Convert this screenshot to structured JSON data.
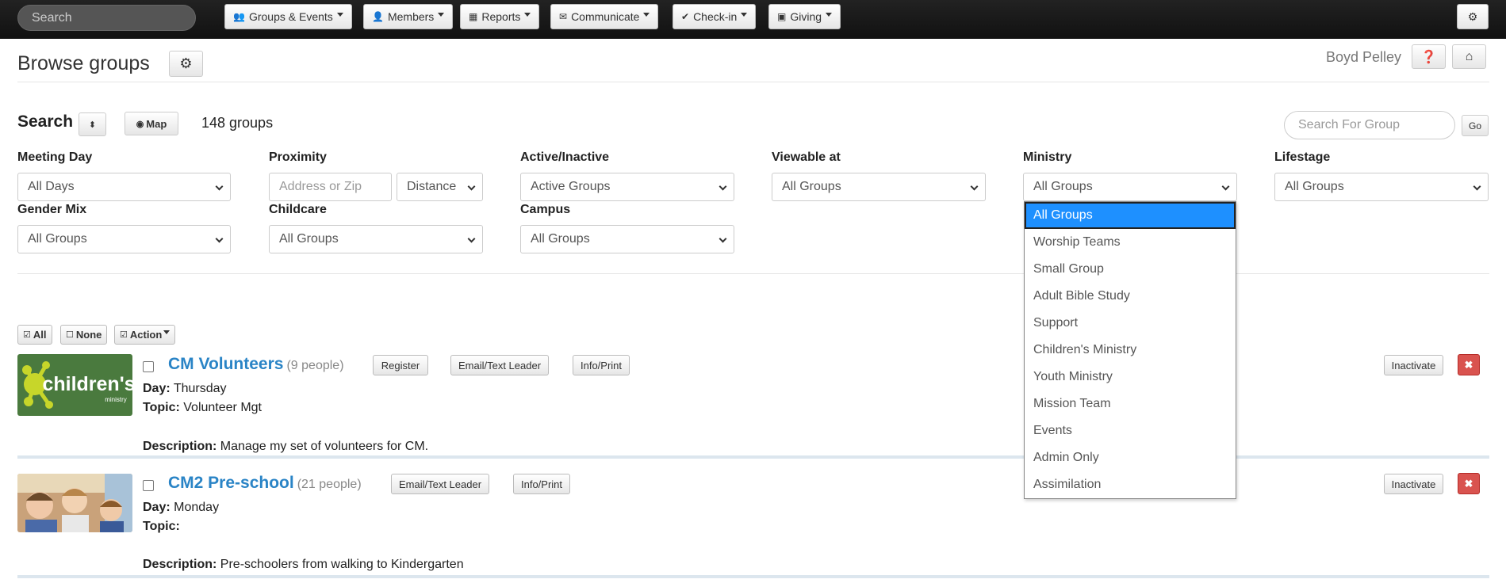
{
  "topnav": {
    "search_placeholder": "Search",
    "menus": [
      {
        "label": "Groups & Events",
        "icon": "users-icon"
      },
      {
        "label": "Members",
        "icon": "user-icon"
      },
      {
        "label": "Reports",
        "icon": "table-icon"
      },
      {
        "label": "Communicate",
        "icon": "envelope-icon"
      },
      {
        "label": "Check-in",
        "icon": "check-icon"
      },
      {
        "label": "Giving",
        "icon": "money-icon"
      }
    ]
  },
  "header": {
    "title": "Browse groups",
    "user_name": "Boyd Pelley"
  },
  "search": {
    "label": "Search",
    "map_label": "Map",
    "count": "148 groups",
    "group_search_placeholder": "Search For Group",
    "go_label": "Go"
  },
  "filters": {
    "meeting_day": {
      "label": "Meeting Day",
      "value": "All Days"
    },
    "proximity": {
      "label": "Proximity",
      "placeholder": "Address or Zip",
      "distance": "Distance"
    },
    "active": {
      "label": "Active/Inactive",
      "value": "Active Groups"
    },
    "viewable": {
      "label": "Viewable at",
      "value": "All Groups"
    },
    "ministry": {
      "label": "Ministry",
      "value": "All Groups"
    },
    "lifestage": {
      "label": "Lifestage",
      "value": "All Groups"
    },
    "gender": {
      "label": "Gender Mix",
      "value": "All Groups"
    },
    "childcare": {
      "label": "Childcare",
      "value": "All Groups"
    },
    "campus": {
      "label": "Campus",
      "value": "All Groups"
    }
  },
  "ministry_options": [
    "All Groups",
    "Worship Teams",
    "Small Group",
    "Adult Bible Study",
    "Support",
    "Children's Ministry",
    "Youth Ministry",
    "Mission Team",
    "Events",
    "Admin Only",
    "Assimilation"
  ],
  "actions": {
    "all": "All",
    "none": "None",
    "action": "Action"
  },
  "groups": [
    {
      "name": "CM Volunteers",
      "people": "(9 people)",
      "day_label": "Day:",
      "day": "Thursday",
      "topic_label": "Topic:",
      "topic": "Volunteer Mgt",
      "desc_label": "Description:",
      "desc": "Manage my set of volunteers for CM.",
      "register": "Register",
      "email": "Email/Text Leader",
      "info": "Info/Print",
      "inactivate": "Inactivate",
      "thumb_text": "children's",
      "thumb_subtext": "ministry"
    },
    {
      "name": "CM2 Pre-school",
      "people": "(21 people)",
      "day_label": "Day:",
      "day": "Monday",
      "topic_label": "Topic:",
      "topic": "",
      "desc_label": "Description:",
      "desc": "Pre-schoolers from walking to Kindergarten",
      "email": "Email/Text Leader",
      "info": "Info/Print",
      "inactivate": "Inactivate"
    }
  ],
  "colors": {
    "link": "#2a84c6",
    "danger": "#d9534f",
    "selected": "#1e90ff"
  }
}
